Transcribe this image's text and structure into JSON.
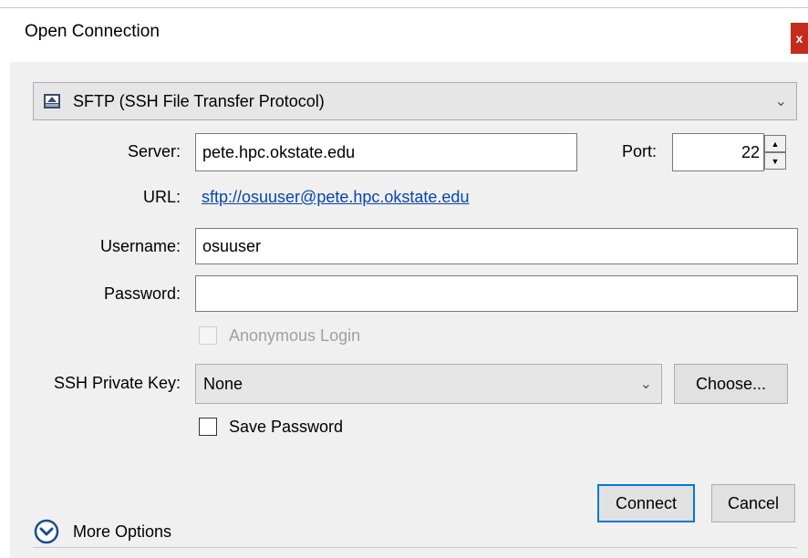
{
  "window": {
    "title": "Open Connection",
    "close_label": "x"
  },
  "protocol": {
    "selected": "SFTP (SSH File Transfer Protocol)"
  },
  "server": {
    "label": "Server:",
    "value": "pete.hpc.okstate.edu"
  },
  "port": {
    "label": "Port:",
    "value": "22"
  },
  "url": {
    "label": "URL:",
    "value": "sftp://osuuser@pete.hpc.okstate.edu"
  },
  "username": {
    "label": "Username:",
    "value": "osuuser"
  },
  "password": {
    "label": "Password:",
    "value": ""
  },
  "anonymous": {
    "label": "Anonymous Login",
    "checked": false,
    "enabled": false
  },
  "ssh_key": {
    "label": "SSH Private Key:",
    "selected": "None",
    "choose_label": "Choose..."
  },
  "save_password": {
    "label": "Save Password",
    "checked": false
  },
  "buttons": {
    "connect": "Connect",
    "cancel": "Cancel"
  },
  "more_options": {
    "label": "More Options"
  },
  "colors": {
    "close_bg": "#c42b1c",
    "link": "#0645ad",
    "focus": "#0078d7"
  },
  "icons": {
    "protocol": "drive-icon",
    "more": "chevron-down-circle-icon"
  }
}
